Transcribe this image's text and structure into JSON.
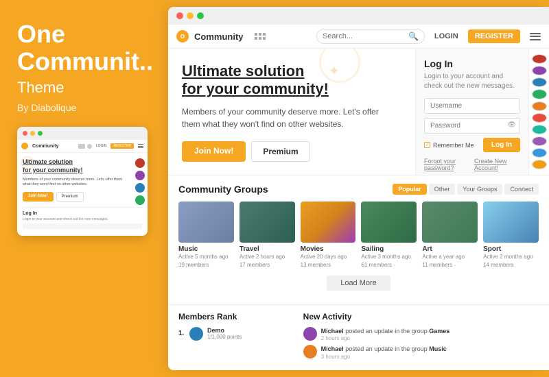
{
  "left": {
    "title": "One",
    "title_cont": "Communit..",
    "subtitle": "Theme",
    "by": "By Diabolique"
  },
  "navbar": {
    "logo_text": "Community",
    "search_placeholder": "Search...",
    "login_label": "LOGIN",
    "register_label": "REGISTER"
  },
  "hero": {
    "title_line1": "Ultimate solution",
    "title_line2": "for your community!",
    "subtitle": "Members of your community deserve more. Let's offer them what they won't find on other websites.",
    "join_label": "Join Now!",
    "premium_label": "Premium"
  },
  "login_box": {
    "title": "Log In",
    "description": "Login to your account and check out the new messages.",
    "username_placeholder": "Username",
    "password_placeholder": "Password",
    "remember_label": "Remember Me",
    "login_btn": "Log In",
    "forgot_label": "Forgot your password?",
    "create_label": "Create New Account!"
  },
  "groups": {
    "title": "Community Groups",
    "filter_tabs": [
      "Popular",
      "Other",
      "Your Groups",
      "Connect"
    ],
    "load_more": "Load More",
    "items": [
      {
        "name": "Music",
        "meta": "Active 5 months ago\n19 members",
        "color": "img-music"
      },
      {
        "name": "Travel",
        "meta": "Active 2 hours ago\n17 members",
        "color": "img-travel"
      },
      {
        "name": "Movies",
        "meta": "Active 20 days ago\n13 members",
        "color": "img-movies"
      },
      {
        "name": "Sailing",
        "meta": "Active 3 months ago\n61 members",
        "color": "img-sailing"
      },
      {
        "name": "Art",
        "meta": "Active a year ago\n11 members",
        "color": "img-art"
      },
      {
        "name": "Sport",
        "meta": "Active 2 months ago\n14 members",
        "color": "img-sport"
      }
    ]
  },
  "members_rank": {
    "title": "Members Rank",
    "items": [
      {
        "rank": "1.",
        "name": "Demo",
        "points": "1/1,000 points"
      }
    ]
  },
  "new_activity": {
    "title": "New Activity",
    "items": [
      {
        "text": "Michael posted an update in the group Games",
        "time": "2 hours ago"
      },
      {
        "text": "Michael posted an update in the group Music",
        "time": "3 hours ago"
      }
    ]
  },
  "avatars": [
    {
      "color": "av1"
    },
    {
      "color": "av2"
    },
    {
      "color": "av3"
    },
    {
      "color": "av4"
    },
    {
      "color": "av5"
    },
    {
      "color": "av6"
    },
    {
      "color": "av7"
    },
    {
      "color": "av8"
    },
    {
      "color": "av9"
    },
    {
      "color": "av10"
    }
  ]
}
